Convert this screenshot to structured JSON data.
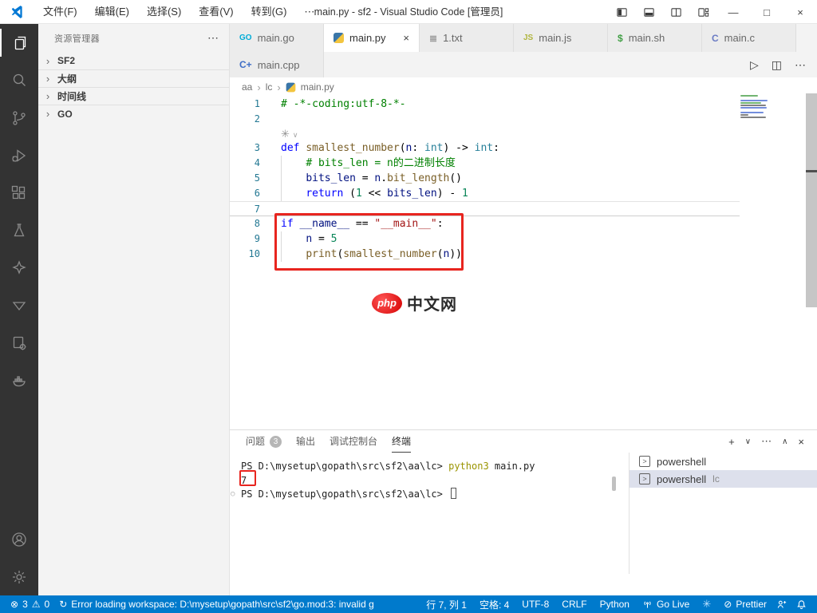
{
  "icons": {
    "close": "×",
    "minimize": "—",
    "maximize": "□",
    "ellipsis": "⋯",
    "run": "▷",
    "split": "◫",
    "plus": "+",
    "chevron_down": "∨",
    "chevron_up": "∧",
    "chevron_right": "›",
    "pinwheel": "✳",
    "circle_slash": "⊘",
    "error": "⊗",
    "warning": "⚠",
    "sync": "↻",
    "decoration": "○",
    "prompt": ">"
  },
  "title_bar": {
    "title": "main.py - sf2 - Visual Studio Code [管理员]",
    "menus": [
      "文件(F)",
      "编辑(E)",
      "选择(S)",
      "查看(V)",
      "转到(G)",
      "⋯"
    ]
  },
  "sidebar": {
    "header": "资源管理器",
    "sections": [
      "SF2",
      "大纲",
      "时间线",
      "GO"
    ]
  },
  "tabs_row1": [
    {
      "label": "main.go",
      "glyph": "GO",
      "glyph_color": "#00acd7"
    },
    {
      "label": "main.py",
      "type": "python",
      "active": true,
      "close": true
    },
    {
      "label": "1.txt",
      "glyph": "≣",
      "glyph_color": "#9d9d9d"
    },
    {
      "label": "main.js",
      "glyph": "JS",
      "glyph_color": "#b0b53e"
    },
    {
      "label": "main.sh",
      "glyph": "$",
      "glyph_color": "#43a047"
    },
    {
      "label": "main.c",
      "glyph": "C",
      "glyph_color": "#6a7bc4"
    }
  ],
  "tabs_row2": [
    {
      "label": "main.cpp",
      "glyph": "C+",
      "glyph_color": "#3f6ec6"
    }
  ],
  "breadcrumbs": [
    "aa",
    "lc",
    "main.py"
  ],
  "code": {
    "lines": [
      {
        "n": "1",
        "tokens": [
          [
            "# -*-coding:utf-8-*-",
            "com"
          ]
        ]
      },
      {
        "n": "2",
        "tokens": []
      },
      {
        "widget": true
      },
      {
        "n": "3",
        "tokens": [
          [
            "def",
            "kw"
          ],
          [
            " ",
            ""
          ],
          [
            "smallest_number",
            "fn"
          ],
          [
            "(",
            ""
          ],
          [
            "n",
            "var"
          ],
          [
            ": ",
            ""
          ],
          [
            "int",
            "ty"
          ],
          [
            ") -> ",
            ""
          ],
          [
            "int",
            "ty"
          ],
          [
            ":",
            ""
          ]
        ]
      },
      {
        "n": "4",
        "guide": true,
        "tokens": [
          [
            "    ",
            ""
          ],
          [
            "# bits_len = n的二进制长度",
            "com"
          ]
        ]
      },
      {
        "n": "5",
        "guide": true,
        "tokens": [
          [
            "    ",
            ""
          ],
          [
            "bits_len",
            "var"
          ],
          [
            " = ",
            ""
          ],
          [
            "n",
            "var"
          ],
          [
            ".",
            ""
          ],
          [
            "bit_length",
            "fn"
          ],
          [
            "()",
            ""
          ]
        ]
      },
      {
        "n": "6",
        "guide": true,
        "tokens": [
          [
            "    ",
            ""
          ],
          [
            "return",
            "kw"
          ],
          [
            " (",
            ""
          ],
          [
            "1",
            "num"
          ],
          [
            " << ",
            ""
          ],
          [
            "bits_len",
            "var"
          ],
          [
            ") - ",
            ""
          ],
          [
            "1",
            "num"
          ]
        ]
      },
      {
        "n": "7",
        "current": true,
        "tokens": []
      },
      {
        "n": "8",
        "tokens": [
          [
            "if",
            "kw"
          ],
          [
            " ",
            ""
          ],
          [
            "__name__",
            "var"
          ],
          [
            " == ",
            ""
          ],
          [
            "\"__main__\"",
            "str"
          ],
          [
            ":",
            ""
          ]
        ]
      },
      {
        "n": "9",
        "guide": true,
        "tokens": [
          [
            "    ",
            ""
          ],
          [
            "n",
            "var"
          ],
          [
            " = ",
            ""
          ],
          [
            "5",
            "num"
          ]
        ]
      },
      {
        "n": "10",
        "guide": true,
        "tokens": [
          [
            "    ",
            ""
          ],
          [
            "print",
            "fn"
          ],
          [
            "(",
            ""
          ],
          [
            "smallest_number",
            "fn"
          ],
          [
            "(",
            ""
          ],
          [
            "n",
            "var"
          ],
          [
            "))",
            ""
          ]
        ]
      }
    ]
  },
  "watermark": {
    "badge": "php",
    "text": "中文网"
  },
  "panel": {
    "tabs": [
      {
        "label": "问题",
        "badge": "3"
      },
      {
        "label": "输出"
      },
      {
        "label": "调试控制台"
      },
      {
        "label": "终端",
        "active": true
      }
    ]
  },
  "terminal": {
    "lines": [
      {
        "parts": [
          [
            "PS D:\\mysetup\\gopath\\src\\sf2\\aa\\lc> ",
            "t"
          ],
          [
            "python3",
            "cmd"
          ],
          [
            " main.py",
            "t"
          ]
        ]
      },
      {
        "parts": [
          [
            "7",
            "t"
          ]
        ]
      },
      {
        "parts": [
          [
            "PS D:\\mysetup\\gopath\\src\\sf2\\aa\\lc> ",
            "t"
          ]
        ],
        "decorated": true,
        "cursor": true
      }
    ],
    "list": [
      {
        "label": "powershell",
        "suffix": ""
      },
      {
        "label": "powershell",
        "suffix": "lc",
        "selected": true
      }
    ]
  },
  "status_bar": {
    "errors": "3",
    "warnings": "0",
    "message": "Error loading workspace: D:\\mysetup\\gopath\\src\\sf2\\go.mod:3: invalid g",
    "items_right": [
      {
        "label": "行 7, 列 1",
        "name": "cursor-position"
      },
      {
        "label": "空格: 4",
        "name": "indentation"
      },
      {
        "label": "UTF-8",
        "name": "encoding"
      },
      {
        "label": "CRLF",
        "name": "eol"
      },
      {
        "label": "Python",
        "name": "language-mode"
      },
      {
        "label": "Go Live",
        "icon": "broadcast",
        "name": "go-live"
      },
      {
        "label": "",
        "icon": "ai",
        "name": "ai-extension"
      },
      {
        "label": "Prettier",
        "icon": "circle_slash",
        "name": "prettier"
      }
    ]
  }
}
